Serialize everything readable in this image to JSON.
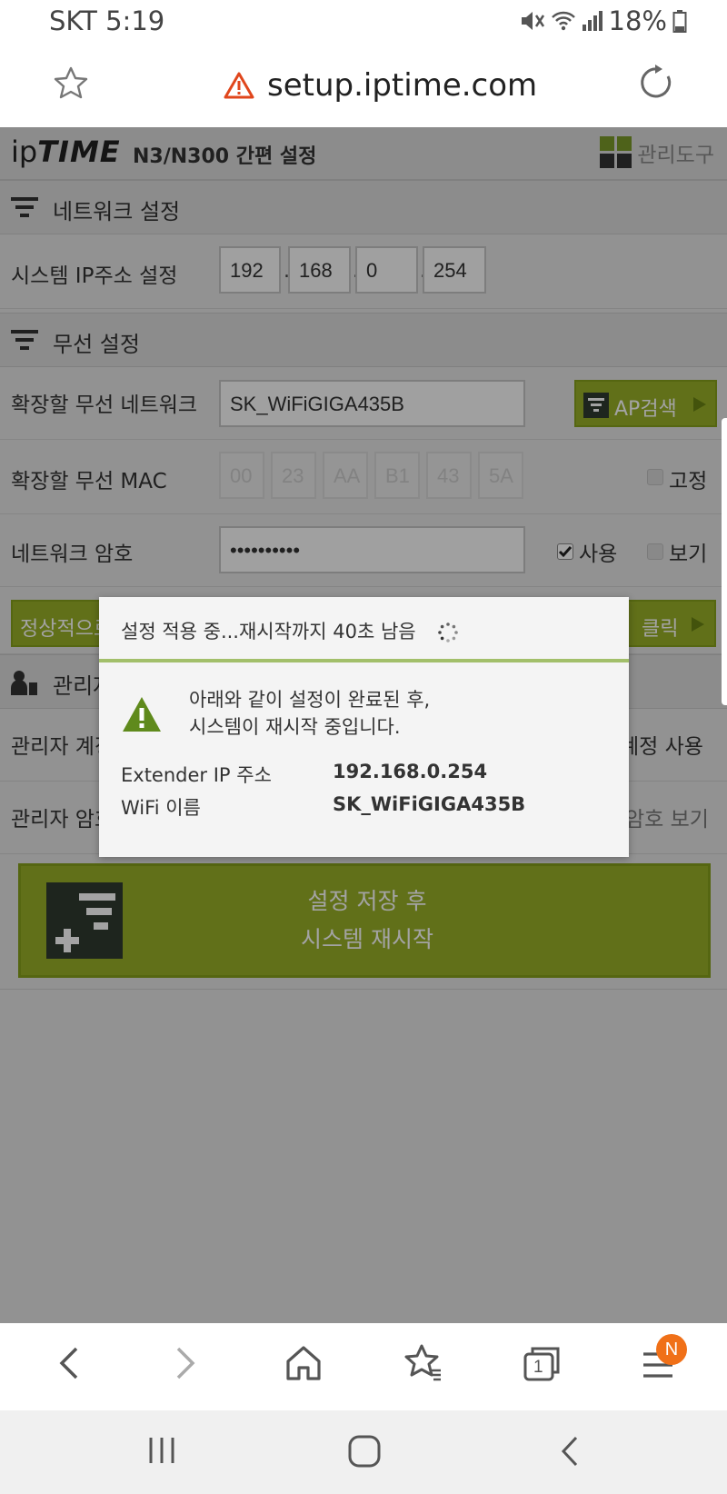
{
  "status_bar": {
    "carrier_time": "SKT 5:19",
    "battery": "18%"
  },
  "browser": {
    "url": "setup.iptime.com"
  },
  "header": {
    "logo_left": "ip",
    "logo_right": "TIME",
    "title": "N3/N300 간편 설정",
    "mgmt_tool": "관리도구"
  },
  "network_section": {
    "title": "네트워크 설정",
    "ip_label": "시스템 IP주소 설정",
    "ip_octets": [
      "192",
      "168",
      "0",
      "254"
    ]
  },
  "wireless_section": {
    "title": "무선 설정",
    "ssid_label": "확장할 무선 네트워크",
    "ssid_value": "SK_WiFiGIGA435B",
    "ap_search": "AP검색",
    "mac_label": "확장할 무선 MAC",
    "mac_octets": [
      "00",
      "23",
      "AA",
      "B1",
      "43",
      "5A"
    ],
    "fixed_label": "고정",
    "password_label": "네트워크 암호",
    "password_value": "••••••••••",
    "use_label": "사용",
    "show_label": "보기",
    "normal_partial": "정상적으로",
    "click_label": "클릭"
  },
  "admin_section": {
    "title_partial": "관리자",
    "account_label_partial": "관리자 계정",
    "account_use_partial": "계정 사용",
    "password_label_partial": "관리자 암호",
    "password_show_partial": "암호 보기"
  },
  "save_button": {
    "line1": "설정 저장 후",
    "line2": "시스템 재시작"
  },
  "dialog": {
    "title": "설정 적용 중...재시작까지 40초 남음",
    "message_line1": "아래와 같이 설정이 완료된 후,",
    "message_line2": "시스템이 재시작 중입니다.",
    "ip_key": "Extender IP 주소",
    "ip_value": "192.168.0.254",
    "wifi_key": "WiFi 이름",
    "wifi_value": "SK_WiFiGIGA435B"
  },
  "bottom_nav": {
    "tabs_count": "1",
    "badge": "N"
  },
  "colors": {
    "accent_green": "#98b028",
    "dialog_line": "#a2bf6a",
    "badge_orange": "#f07018",
    "warn_red": "#e0461c"
  }
}
